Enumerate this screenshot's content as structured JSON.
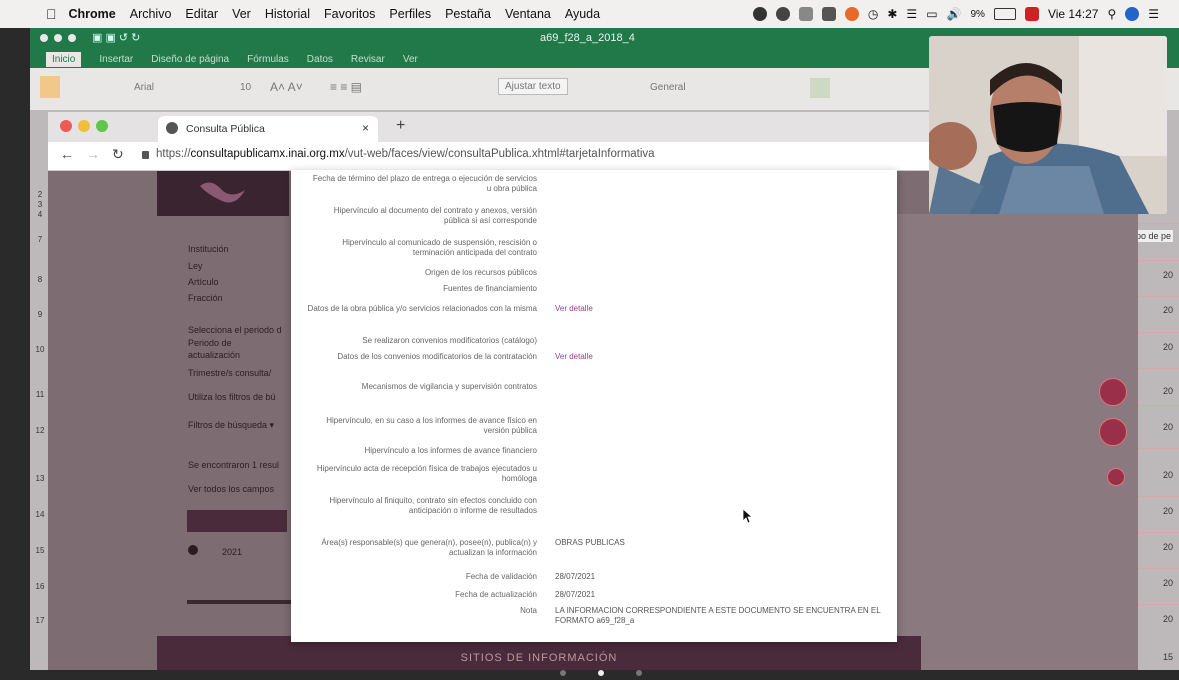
{
  "menubar": {
    "app": "Chrome",
    "items": [
      "Archivo",
      "Editar",
      "Ver",
      "Historial",
      "Favoritos",
      "Perfiles",
      "Pestaña",
      "Ventana",
      "Ayuda"
    ],
    "battery": "9%",
    "clock": "Vie 14:27"
  },
  "excel": {
    "title": "a69_f28_a_2018_4",
    "tabs": [
      "Inicio",
      "Insertar",
      "Diseño de página",
      "Fórmulas",
      "Datos",
      "Revisar",
      "Ver"
    ],
    "font_name": "Arial",
    "font_size": "10",
    "wrap_text": "Ajustar texto",
    "number_format": "General",
    "rows": [
      "2",
      "3",
      "4",
      "7",
      "8",
      "9",
      "10",
      "11",
      "12",
      "13",
      "14",
      "15",
      "16",
      "17"
    ],
    "right_header": "po de pe",
    "right_values": [
      "20",
      "20",
      "20",
      "20",
      "20",
      "20",
      "20",
      "20",
      "20",
      "20"
    ],
    "bottom_right": "15"
  },
  "page": {
    "left_labels": [
      "Institución",
      "Ley",
      "Artículo",
      "Fracción",
      "Selecciona el periodo d",
      "Periodo de",
      "actualización",
      "Trimestre/s consulta/",
      "Utiliza los filtros de bú",
      "Filtros de búsqueda ▾",
      "Se encontraron 1 resul",
      "Ver todos los campos",
      "2021"
    ],
    "footer": "SITIOS DE INFORMACIÓN"
  },
  "chrome": {
    "tab_title": "Consulta Pública",
    "url_prefix": "https://",
    "url_host": "consultapublicamx.inai.org.mx",
    "url_path": "/vut-web/faces/view/consultaPublica.xhtml#tarjetaInformativa"
  },
  "modal": {
    "fields": [
      {
        "label": "Fecha de término del plazo de entrega o ejecución de servicios u obra pública",
        "value": ""
      },
      {
        "label": "Hipervínculo al documento del contrato y anexos, versión pública si así corresponde",
        "value": ""
      },
      {
        "label": "Hipervínculo al comunicado de suspensión, rescisión o terminación anticipada del contrato",
        "value": ""
      },
      {
        "label": "Origen de los recursos públicos",
        "value": ""
      },
      {
        "label": "Fuentes de financiamiento",
        "value": ""
      },
      {
        "label": "Datos de la obra pública y/o servicios relacionados con la misma",
        "value": "Ver detalle",
        "link": true
      },
      {
        "label": "Se realizaron convenios modificatorios (catálogo)",
        "value": ""
      },
      {
        "label": "Datos de los convenios modificatorios de la contratación",
        "value": "Ver detalle",
        "link": true
      },
      {
        "label": "Mecanismos de vigilancia y supervisión contratos",
        "value": ""
      },
      {
        "label": "Hipervínculo, en su caso a los informes de avance físico en versión pública",
        "value": ""
      },
      {
        "label": "Hipervínculo a los informes de avance financiero",
        "value": ""
      },
      {
        "label": "Hipervínculo acta de recepción física de trabajos ejecutados u homóloga",
        "value": ""
      },
      {
        "label": "Hipervínculo al finiquito, contrato sin efectos concluido con anticipación o informe de resultados",
        "value": ""
      },
      {
        "label": "Área(s) responsable(s) que genera(n), posee(n), publica(n) y actualizan la información",
        "value": "OBRAS PUBLICAS"
      },
      {
        "label": "Fecha de validación",
        "value": "28/07/2021"
      },
      {
        "label": "Fecha de actualización",
        "value": "28/07/2021"
      },
      {
        "label": "Nota",
        "value": "LA INFORMACION CORRESPONDIENTE A ESTE DOCUMENTO SE ENCUENTRA EN EL FORMATO a69_f28_a"
      }
    ]
  },
  "colors": {
    "excel_green": "#21794a",
    "link": "#9b3a8b",
    "maroon": "#4a2b3b",
    "alert_red": "#9a2f4a"
  }
}
